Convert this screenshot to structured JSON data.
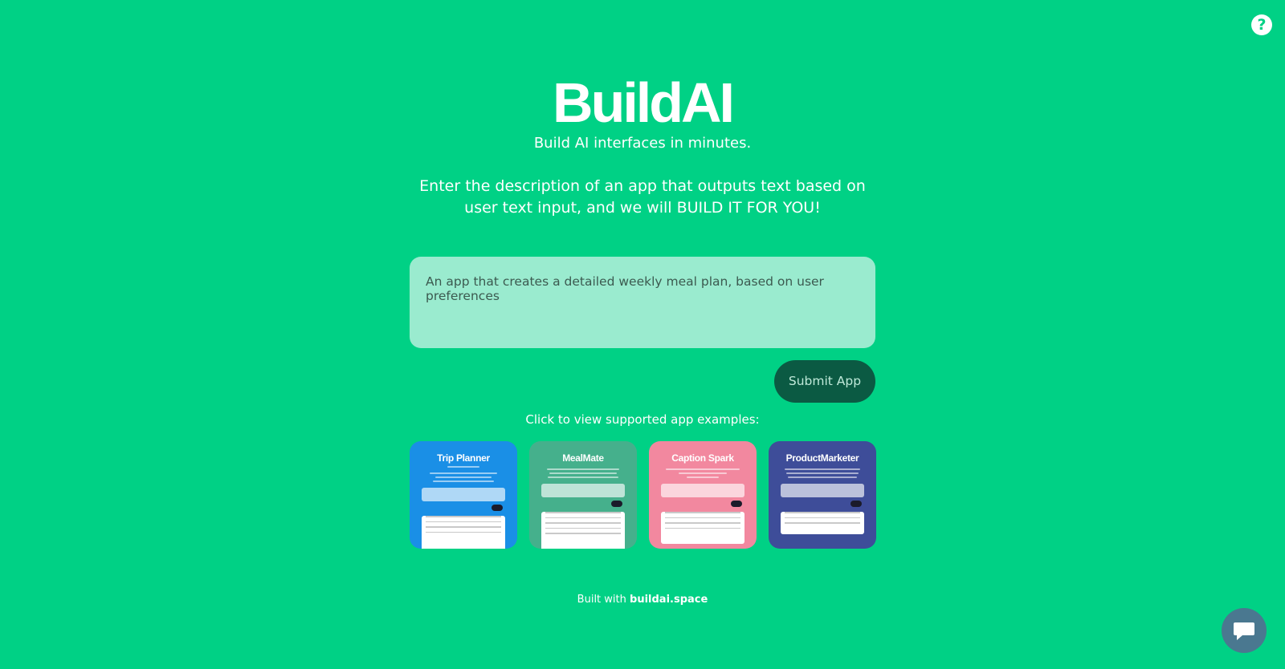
{
  "header": {
    "help_icon": "question-circle-icon"
  },
  "hero": {
    "logo": "BuildAI",
    "tagline": "Build AI interfaces in minutes.",
    "description": "Enter the description of an app that outputs text based on user text input, and we will BUILD IT FOR YOU!"
  },
  "form": {
    "prompt_value": "An app that creates a detailed weekly meal plan, based on user preferences",
    "submit_label": "Submit App"
  },
  "examples": {
    "label": "Click to view supported app examples:",
    "cards": [
      {
        "title": "Trip Planner",
        "color": "#1a8fe6"
      },
      {
        "title": "MealMate",
        "color": "#45b08c"
      },
      {
        "title": "Caption Spark",
        "color": "#f2889f"
      },
      {
        "title": "ProductMarketer",
        "color": "#3e4d99"
      }
    ]
  },
  "footer": {
    "prefix": "Built with",
    "link": "buildai.space"
  },
  "chat": {
    "icon": "chat-bubble-icon"
  }
}
